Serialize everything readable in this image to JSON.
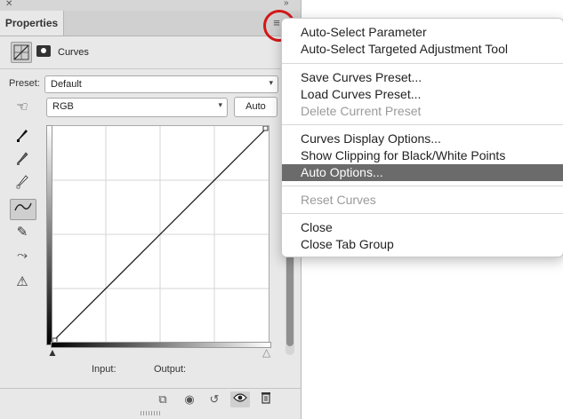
{
  "panel": {
    "tab_label": "Properties",
    "close_glyph": "✕",
    "collapse_glyph": "»",
    "menu_glyph": "≡",
    "adjustment_label": "Curves",
    "preset_label": "Preset:",
    "preset_value": "Default",
    "channel_value": "RGB",
    "auto_label": "Auto",
    "input_label": "Input:",
    "output_label": "Output:",
    "highlight_color": "#d41717"
  },
  "tools": [
    {
      "name": "target-adjust-icon",
      "glyph": "☜"
    },
    {
      "name": "black-point-eyedropper-icon",
      "glyph": "✒"
    },
    {
      "name": "gray-point-eyedropper-icon",
      "glyph": "✒"
    },
    {
      "name": "white-point-eyedropper-icon",
      "glyph": "✒"
    },
    {
      "name": "curve-point-tool-icon",
      "glyph": "∿"
    },
    {
      "name": "pencil-tool-icon",
      "glyph": "✎"
    },
    {
      "name": "smooth-curve-icon",
      "glyph": "⤳"
    },
    {
      "name": "clipping-warning-icon",
      "glyph": "⚠"
    }
  ],
  "bottom_icons": {
    "clip_to_layer": "⧉",
    "view_previous": "◉",
    "reset": "↺",
    "visibility": "👁",
    "delete": "🗑"
  },
  "menu": {
    "items": [
      {
        "label": "Auto-Select Parameter",
        "disabled": false
      },
      {
        "label": "Auto-Select Targeted Adjustment Tool",
        "disabled": false
      },
      {
        "label": "Save Curves Preset...",
        "disabled": false
      },
      {
        "label": "Load Curves Preset...",
        "disabled": false
      },
      {
        "label": "Delete Current Preset",
        "disabled": true
      },
      {
        "label": "Curves Display Options...",
        "disabled": false
      },
      {
        "label": "Show Clipping for Black/White Points",
        "disabled": false
      },
      {
        "label": "Auto Options...",
        "disabled": false,
        "highlighted": true
      },
      {
        "label": "Reset Curves",
        "disabled": true
      },
      {
        "label": "Close",
        "disabled": false
      },
      {
        "label": "Close Tab Group",
        "disabled": false
      }
    ]
  }
}
